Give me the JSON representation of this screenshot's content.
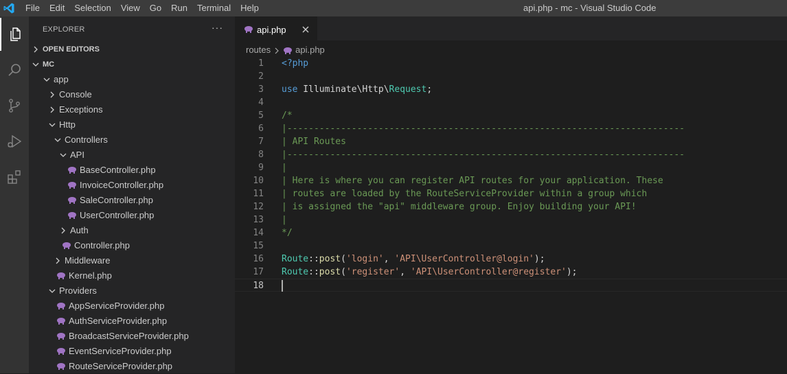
{
  "window": {
    "title": "api.php - mc - Visual Studio Code",
    "menu": [
      "File",
      "Edit",
      "Selection",
      "View",
      "Go",
      "Run",
      "Terminal",
      "Help"
    ]
  },
  "activity_bar": {
    "items": [
      "files-icon",
      "search-icon",
      "source-control-icon",
      "run-debug-icon",
      "extensions-icon"
    ],
    "active": "files-icon"
  },
  "sidebar": {
    "header": "EXPLORER",
    "more": "···",
    "sections": {
      "open_editors": "OPEN EDITORS",
      "workspace": "MC"
    },
    "tree": [
      {
        "label": "app",
        "type": "folder",
        "expanded": true
      },
      {
        "label": "Console",
        "type": "folder",
        "expanded": false
      },
      {
        "label": "Exceptions",
        "type": "folder",
        "expanded": false
      },
      {
        "label": "Http",
        "type": "folder",
        "expanded": true
      },
      {
        "label": "Controllers",
        "type": "folder",
        "expanded": true
      },
      {
        "label": "API",
        "type": "folder",
        "expanded": true
      },
      {
        "label": "BaseController.php",
        "type": "php"
      },
      {
        "label": "InvoiceController.php",
        "type": "php"
      },
      {
        "label": "SaleController.php",
        "type": "php"
      },
      {
        "label": "UserController.php",
        "type": "php"
      },
      {
        "label": "Auth",
        "type": "folder",
        "expanded": false
      },
      {
        "label": "Controller.php",
        "type": "php"
      },
      {
        "label": "Middleware",
        "type": "folder",
        "expanded": false
      },
      {
        "label": "Kernel.php",
        "type": "php"
      },
      {
        "label": "Providers",
        "type": "folder",
        "expanded": true
      },
      {
        "label": "AppServiceProvider.php",
        "type": "php"
      },
      {
        "label": "AuthServiceProvider.php",
        "type": "php"
      },
      {
        "label": "BroadcastServiceProvider.php",
        "type": "php"
      },
      {
        "label": "EventServiceProvider.php",
        "type": "php"
      },
      {
        "label": "RouteServiceProvider.php",
        "type": "php"
      }
    ]
  },
  "editor": {
    "tab": {
      "label": "api.php"
    },
    "breadcrumb": {
      "folder": "routes",
      "file": "api.php"
    },
    "current_line": 18,
    "lines": [
      {
        "n": "1",
        "tokens": [
          {
            "t": "<?php",
            "c": "kw"
          }
        ]
      },
      {
        "n": "2",
        "tokens": []
      },
      {
        "n": "3",
        "tokens": [
          {
            "t": "use",
            "c": "kw"
          },
          {
            "t": " Illuminate\\Http\\",
            "c": "plain"
          },
          {
            "t": "Request",
            "c": "cls"
          },
          {
            "t": ";",
            "c": "plain"
          }
        ]
      },
      {
        "n": "4",
        "tokens": []
      },
      {
        "n": "5",
        "tokens": [
          {
            "t": "/*",
            "c": "cmt"
          }
        ]
      },
      {
        "n": "6",
        "tokens": [
          {
            "t": "|--------------------------------------------------------------------------",
            "c": "cmt"
          }
        ]
      },
      {
        "n": "7",
        "tokens": [
          {
            "t": "| API Routes",
            "c": "cmt"
          }
        ]
      },
      {
        "n": "8",
        "tokens": [
          {
            "t": "|--------------------------------------------------------------------------",
            "c": "cmt"
          }
        ]
      },
      {
        "n": "9",
        "tokens": [
          {
            "t": "|",
            "c": "cmt"
          }
        ]
      },
      {
        "n": "10",
        "tokens": [
          {
            "t": "| Here is where you can register API routes for your application. These",
            "c": "cmt"
          }
        ]
      },
      {
        "n": "11",
        "tokens": [
          {
            "t": "| routes are loaded by the RouteServiceProvider within a group which",
            "c": "cmt"
          }
        ]
      },
      {
        "n": "12",
        "tokens": [
          {
            "t": "| is assigned the \"api\" middleware group. Enjoy building your API!",
            "c": "cmt"
          }
        ]
      },
      {
        "n": "13",
        "tokens": [
          {
            "t": "|",
            "c": "cmt"
          }
        ]
      },
      {
        "n": "14",
        "tokens": [
          {
            "t": "*/",
            "c": "cmt"
          }
        ]
      },
      {
        "n": "15",
        "tokens": []
      },
      {
        "n": "16",
        "tokens": [
          {
            "t": "Route",
            "c": "cls"
          },
          {
            "t": "::",
            "c": "plain"
          },
          {
            "t": "post",
            "c": "fn"
          },
          {
            "t": "(",
            "c": "plain"
          },
          {
            "t": "'login'",
            "c": "str"
          },
          {
            "t": ", ",
            "c": "plain"
          },
          {
            "t": "'API\\UserController@login'",
            "c": "str"
          },
          {
            "t": ");",
            "c": "plain"
          }
        ]
      },
      {
        "n": "17",
        "tokens": [
          {
            "t": "Route",
            "c": "cls"
          },
          {
            "t": "::",
            "c": "plain"
          },
          {
            "t": "post",
            "c": "fn"
          },
          {
            "t": "(",
            "c": "plain"
          },
          {
            "t": "'register'",
            "c": "str"
          },
          {
            "t": ", ",
            "c": "plain"
          },
          {
            "t": "'API\\UserController@register'",
            "c": "str"
          },
          {
            "t": ");",
            "c": "plain"
          }
        ]
      },
      {
        "n": "18",
        "tokens": []
      }
    ]
  },
  "colors": {
    "titlebar": "#3c3c3c",
    "activitybar": "#333333",
    "sidebar": "#252526",
    "editor": "#1e1e1e",
    "vscode_blue": "#23a9f2",
    "php_icon": "#a074c4"
  }
}
